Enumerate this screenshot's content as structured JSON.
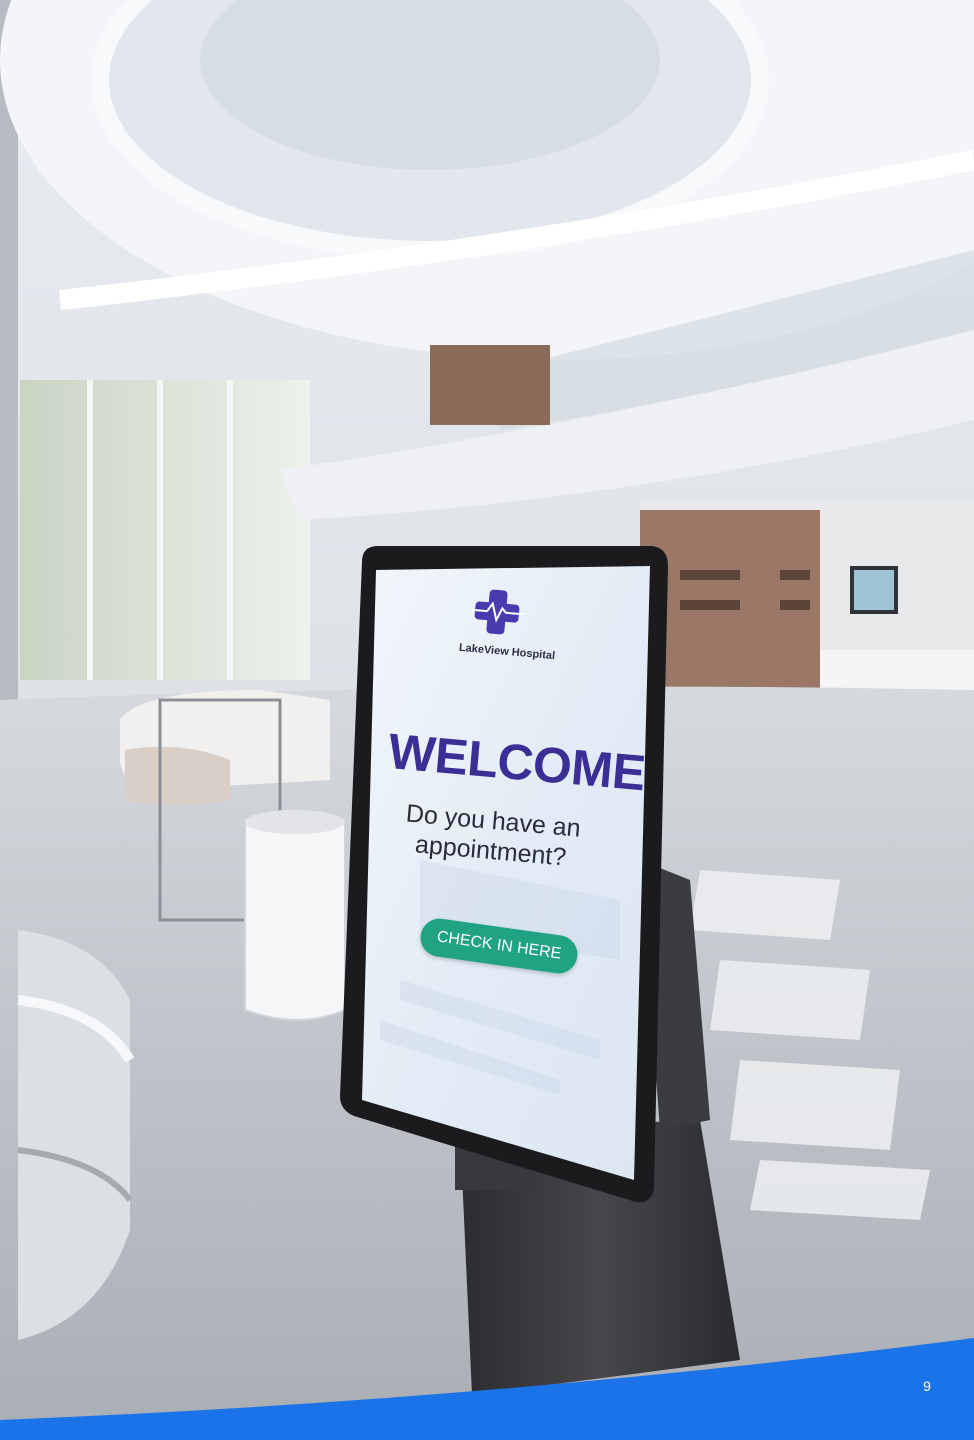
{
  "kiosk_screen": {
    "hospital_name": "LakeView Hospital",
    "heading": "WELCOME",
    "question": "Do you have an appointment?",
    "button_label": "CHECK IN HERE"
  },
  "footer": {
    "page_number": "9",
    "band_color": "#1a73e8"
  },
  "colors": {
    "heading": "#3b2f96",
    "button": "#1fa383",
    "logo_cross": "#4a3ab0"
  },
  "icons": {
    "logo": "medical-cross-heartbeat-icon"
  }
}
